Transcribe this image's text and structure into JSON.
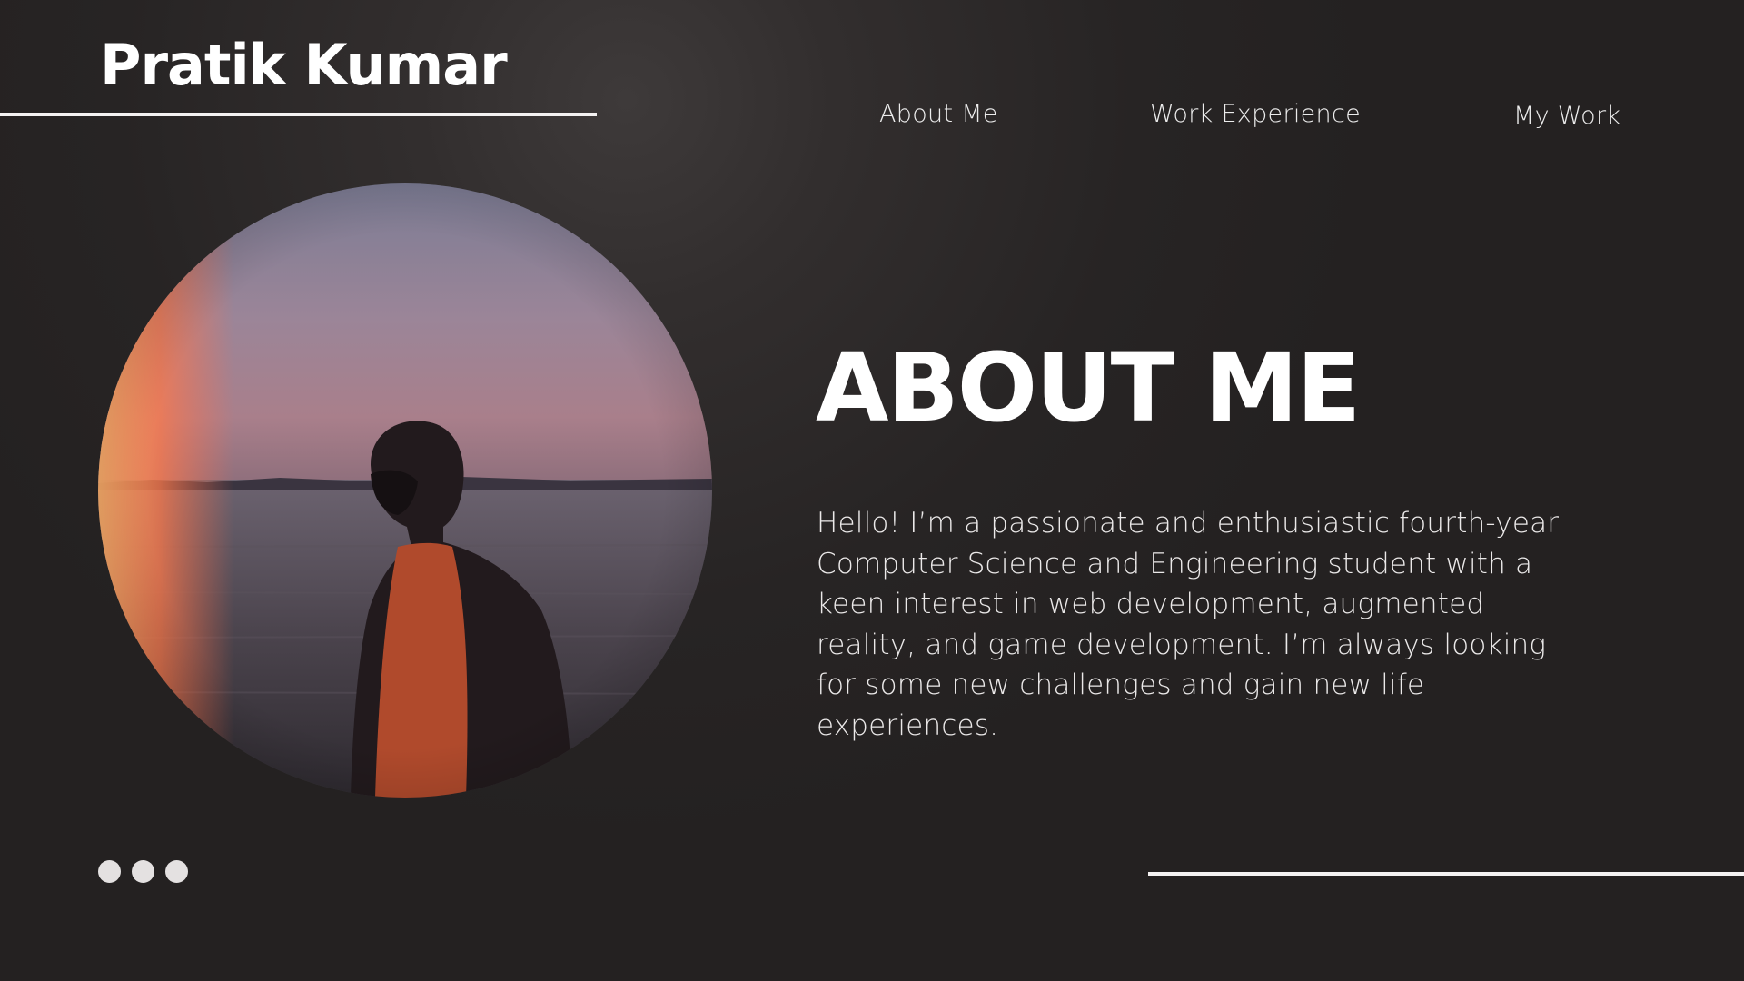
{
  "header": {
    "brand_name": "Pratik Kumar"
  },
  "nav": {
    "items": [
      {
        "label": "About Me"
      },
      {
        "label": "Work Experience"
      },
      {
        "label": "My Work"
      }
    ]
  },
  "main": {
    "heading": "ABOUT ME",
    "bio": "Hello! I’m a passionate and enthusiastic fourth-year Computer Science and Engineering student with a keen interest in web development, augmented reality, and game development. I’m always looking for some new challenges and gain new life experiences."
  },
  "pagination": {
    "dot_count": 3
  },
  "colors": {
    "background": "#242121",
    "text": "#ffffff",
    "accent_rule": "#f4f2f2"
  },
  "icons": {
    "pagination": "dot-icon"
  }
}
